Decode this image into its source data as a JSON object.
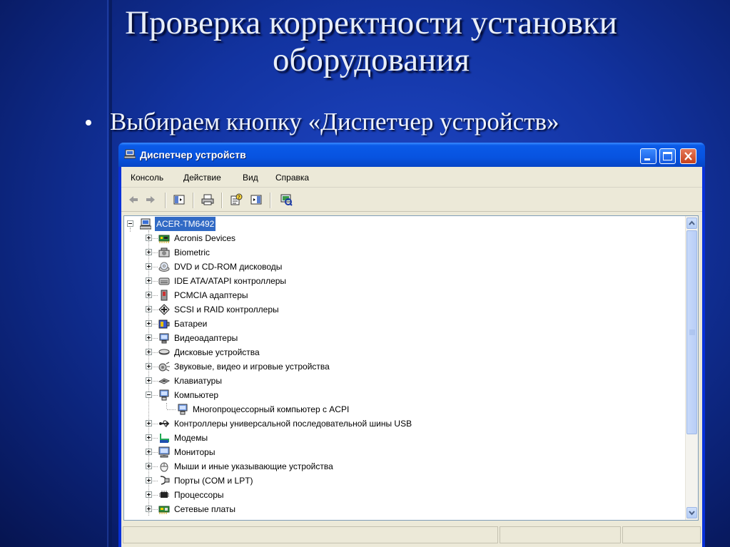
{
  "slide": {
    "title": "Проверка корректности установки оборудования",
    "bullet": "Выбираем кнопку «Диспетчер устройств»"
  },
  "window": {
    "title": "Диспетчер устройств",
    "menu": [
      "Консоль",
      "Действие",
      "Вид",
      "Справка"
    ],
    "toolbar_icons": [
      "back-arrow-icon",
      "forward-arrow-icon",
      "show-hide-tree-icon",
      "print-icon",
      "properties-icon",
      "help-icon",
      "scan-hardware-icon"
    ]
  },
  "tree": {
    "root": "ACER-TM6492",
    "items": [
      {
        "label": "Acronis Devices",
        "icon": "board-icon",
        "expanded": false
      },
      {
        "label": "Biometric",
        "icon": "biometric-icon",
        "expanded": false
      },
      {
        "label": "DVD и CD-ROM дисководы",
        "icon": "cdrom-icon",
        "expanded": false
      },
      {
        "label": "IDE ATA/ATAPI контроллеры",
        "icon": "ide-icon",
        "expanded": false
      },
      {
        "label": "PCMCIA адаптеры",
        "icon": "pcmcia-icon",
        "expanded": false
      },
      {
        "label": "SCSI и RAID контроллеры",
        "icon": "scsi-icon",
        "expanded": false
      },
      {
        "label": "Батареи",
        "icon": "battery-icon",
        "expanded": false
      },
      {
        "label": "Видеоадаптеры",
        "icon": "display-adapter-icon",
        "expanded": false
      },
      {
        "label": "Дисковые устройства",
        "icon": "disk-icon",
        "expanded": false
      },
      {
        "label": "Звуковые, видео и игровые устройства",
        "icon": "sound-icon",
        "expanded": false
      },
      {
        "label": "Клавиатуры",
        "icon": "keyboard-icon",
        "expanded": false
      },
      {
        "label": "Компьютер",
        "icon": "computer-icon",
        "expanded": true
      },
      {
        "label": "Многопроцессорный компьютер с ACPI",
        "icon": "computer-icon",
        "child": true
      },
      {
        "label": "Контроллеры универсальной последовательной шины USB",
        "icon": "usb-icon",
        "expanded": false
      },
      {
        "label": "Модемы",
        "icon": "modem-icon",
        "expanded": false
      },
      {
        "label": "Мониторы",
        "icon": "monitor-icon",
        "expanded": false
      },
      {
        "label": "Мыши и иные указывающие устройства",
        "icon": "mouse-icon",
        "expanded": false
      },
      {
        "label": "Порты (COM и LPT)",
        "icon": "port-icon",
        "expanded": false
      },
      {
        "label": "Процессоры",
        "icon": "cpu-icon",
        "expanded": false
      },
      {
        "label": "Сетевые платы",
        "icon": "network-card-icon",
        "expanded": false
      }
    ]
  }
}
